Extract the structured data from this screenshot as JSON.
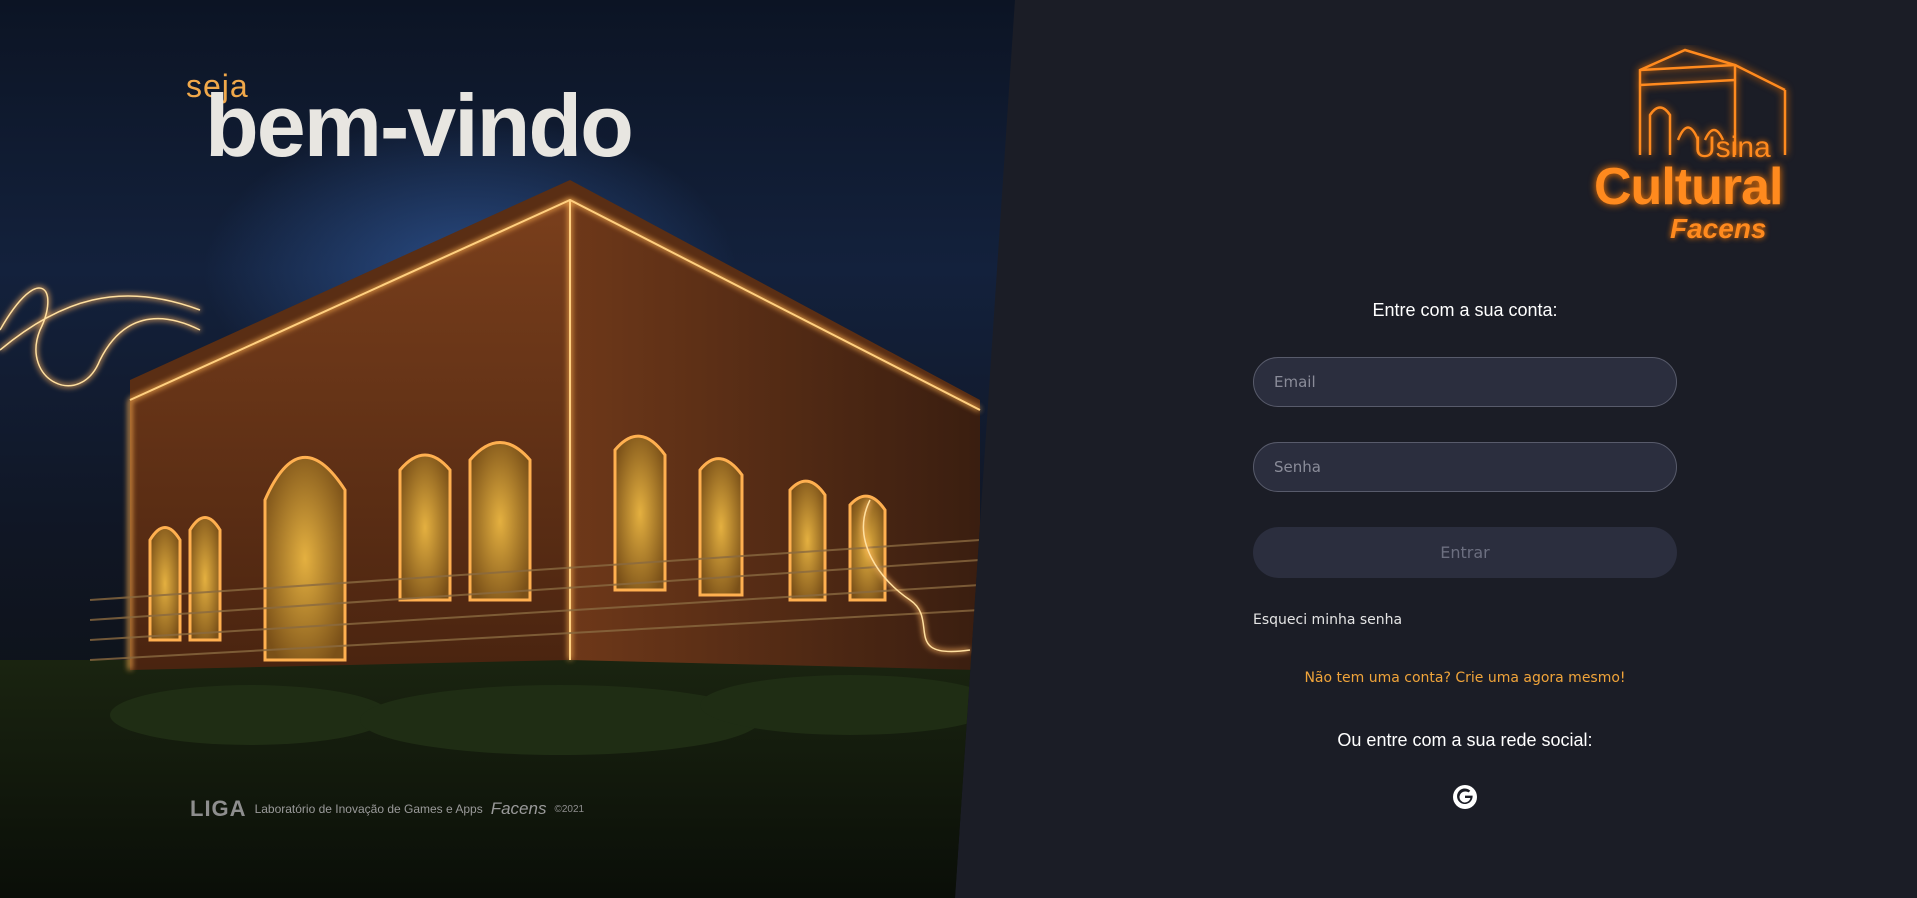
{
  "hero": {
    "greeting_small": "seja",
    "greeting_large": "bem-vindo"
  },
  "credit": {
    "liga": "LIGA",
    "text": "Laboratório de Inovação de Games e Apps",
    "facens": "Facens",
    "year": "©2021"
  },
  "logo": {
    "line1": "Usina",
    "line2": "Cultural",
    "line3": "Facens"
  },
  "login": {
    "title": "Entre com a sua conta:",
    "email_placeholder": "Email",
    "password_placeholder": "Senha",
    "submit_label": "Entrar",
    "forgot_label": "Esqueci minha senha",
    "signup_label": "Não tem uma conta? Crie uma agora mesmo!",
    "social_title": "Ou entre com a sua rede social:",
    "social_icon": "google-icon"
  },
  "colors": {
    "accent": "#f0a43a",
    "neon": "#ff8a1e",
    "panel_bg": "#1b1d26",
    "input_bg": "#2b2e3e"
  }
}
